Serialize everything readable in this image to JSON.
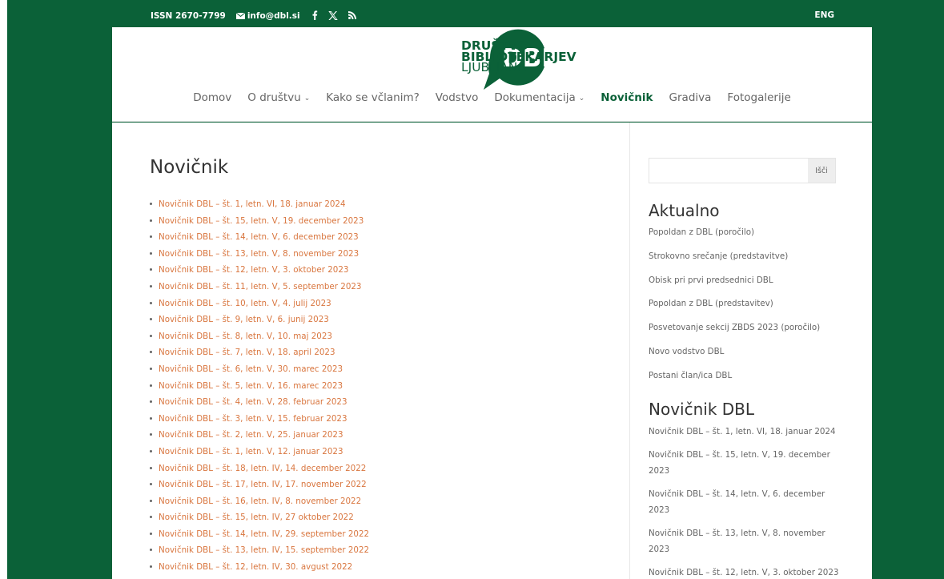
{
  "topbar": {
    "issn": "ISSN 2670-7799",
    "email": "info@dbl.si",
    "language": "ENG",
    "social_icons": [
      "facebook-icon",
      "x-twitter-icon",
      "rss-icon"
    ]
  },
  "logo": {
    "mark": "DBL",
    "line1": "DRUŠTVO",
    "line2": "BIBLIOTEKARJEV",
    "line3": "LJUBLJANA"
  },
  "nav": {
    "items": [
      {
        "label": "Domov",
        "has_dropdown": false,
        "active": false
      },
      {
        "label": "O društvu",
        "has_dropdown": true,
        "active": false
      },
      {
        "label": "Kako se včlanim?",
        "has_dropdown": false,
        "active": false
      },
      {
        "label": "Vodstvo",
        "has_dropdown": false,
        "active": false
      },
      {
        "label": "Dokumentacija",
        "has_dropdown": true,
        "active": false
      },
      {
        "label": "Novičnik",
        "has_dropdown": false,
        "active": true
      },
      {
        "label": "Gradiva",
        "has_dropdown": false,
        "active": false
      },
      {
        "label": "Fotogalerije",
        "has_dropdown": false,
        "active": false
      }
    ],
    "caret": "⌄"
  },
  "main": {
    "title": "Novičnik",
    "items": [
      "Novičnik DBL – št. 1, letn. VI, 18. januar 2024",
      "Novičnik DBL – št. 15, letn. V, 19. december 2023",
      "Novičnik DBL – št. 14, letn. V, 6. december 2023",
      "Novičnik DBL – št. 13, letn. V, 8. november 2023",
      "Novičnik DBL – št. 12, letn. V, 3. oktober 2023",
      "Novičnik DBL – št. 11, letn. V, 5. september 2023",
      "Novičnik DBL – št. 10, letn. V, 4. julij 2023",
      "Novičnik DBL – št. 9, letn. V, 6. junij 2023",
      "Novičnik DBL – št. 8, letn. V, 10. maj 2023",
      "Novičnik DBL – št. 7, letn. V, 18. april 2023",
      "Novičnik DBL – št. 6, letn. V, 30. marec 2023",
      "Novičnik DBL – št. 5, letn. V, 16. marec 2023",
      "Novičnik DBL – št. 4, letn. V, 28. februar 2023",
      "Novičnik DBL – št. 3, letn. V, 15. februar 2023",
      "Novičnik DBL – št. 2, letn. V, 25. januar 2023",
      "Novičnik DBL – št. 1, letn. V, 12. januar 2023",
      "Novičnik DBL – št. 18, letn. IV, 14. december 2022",
      "Novičnik DBL – št. 17, letn. IV, 17. november 2022",
      "Novičnik DBL – št. 16, letn. IV, 8. november 2022",
      "Novičnik DBL – št. 15, letn. IV, 27 oktober 2022",
      "Novičnik DBL – št. 14, letn. IV, 29. september 2022",
      "Novičnik DBL – št. 13, letn. IV, 15. september 2022",
      "Novičnik DBL – št. 12, letn. IV, 30. avgust 2022"
    ]
  },
  "sidebar": {
    "search": {
      "placeholder": "",
      "value": "",
      "button": "Išči"
    },
    "aktualno": {
      "title": "Aktualno",
      "items": [
        "Popoldan z DBL (poročilo)",
        "Strokovno srečanje (predstavitve)",
        "Obisk pri prvi predsednici DBL",
        "Popoldan z DBL (predstavitev)",
        "Posvetovanje sekcij ZBDS 2023 (poročilo)",
        "Novo vodstvo DBL",
        "Postani član/ica DBL"
      ]
    },
    "novicnik": {
      "title": "Novičnik DBL",
      "items": [
        "Novičnik DBL – št. 1, letn. VI, 18. januar 2024",
        "Novičnik DBL – št. 15, letn. V, 19. december 2023",
        "Novičnik DBL – št. 14, letn. V, 6. december 2023",
        "Novičnik DBL – št. 13, letn. V, 8. november 2023",
        "Novičnik DBL – št. 12, letn. V, 3. oktober 2023"
      ]
    }
  },
  "colors": {
    "brand_green": "#0b6138",
    "link_orange": "#d9763f",
    "text_gray": "#666666"
  }
}
